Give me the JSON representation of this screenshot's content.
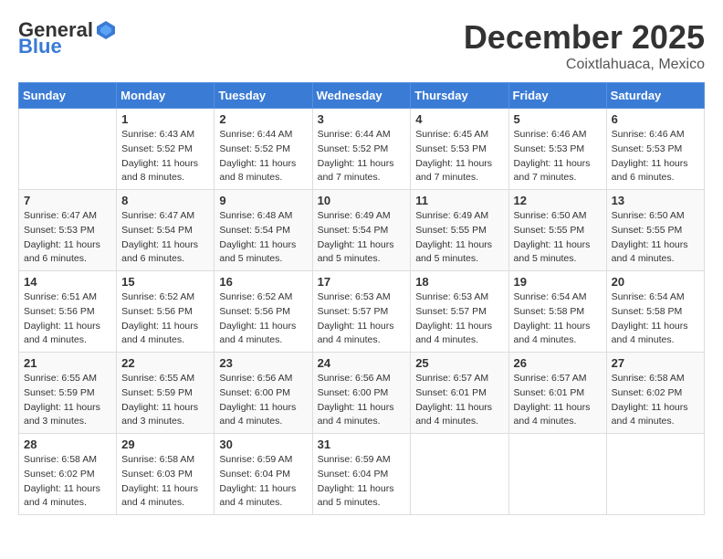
{
  "header": {
    "logo_general": "General",
    "logo_blue": "Blue",
    "month_title": "December 2025",
    "location": "Coixtlahuaca, Mexico"
  },
  "weekdays": [
    "Sunday",
    "Monday",
    "Tuesday",
    "Wednesday",
    "Thursday",
    "Friday",
    "Saturday"
  ],
  "weeks": [
    [
      {
        "day": "",
        "sunrise": "",
        "sunset": "",
        "daylight": ""
      },
      {
        "day": "1",
        "sunrise": "Sunrise: 6:43 AM",
        "sunset": "Sunset: 5:52 PM",
        "daylight": "Daylight: 11 hours and 8 minutes."
      },
      {
        "day": "2",
        "sunrise": "Sunrise: 6:44 AM",
        "sunset": "Sunset: 5:52 PM",
        "daylight": "Daylight: 11 hours and 8 minutes."
      },
      {
        "day": "3",
        "sunrise": "Sunrise: 6:44 AM",
        "sunset": "Sunset: 5:52 PM",
        "daylight": "Daylight: 11 hours and 7 minutes."
      },
      {
        "day": "4",
        "sunrise": "Sunrise: 6:45 AM",
        "sunset": "Sunset: 5:53 PM",
        "daylight": "Daylight: 11 hours and 7 minutes."
      },
      {
        "day": "5",
        "sunrise": "Sunrise: 6:46 AM",
        "sunset": "Sunset: 5:53 PM",
        "daylight": "Daylight: 11 hours and 7 minutes."
      },
      {
        "day": "6",
        "sunrise": "Sunrise: 6:46 AM",
        "sunset": "Sunset: 5:53 PM",
        "daylight": "Daylight: 11 hours and 6 minutes."
      }
    ],
    [
      {
        "day": "7",
        "sunrise": "Sunrise: 6:47 AM",
        "sunset": "Sunset: 5:53 PM",
        "daylight": "Daylight: 11 hours and 6 minutes."
      },
      {
        "day": "8",
        "sunrise": "Sunrise: 6:47 AM",
        "sunset": "Sunset: 5:54 PM",
        "daylight": "Daylight: 11 hours and 6 minutes."
      },
      {
        "day": "9",
        "sunrise": "Sunrise: 6:48 AM",
        "sunset": "Sunset: 5:54 PM",
        "daylight": "Daylight: 11 hours and 5 minutes."
      },
      {
        "day": "10",
        "sunrise": "Sunrise: 6:49 AM",
        "sunset": "Sunset: 5:54 PM",
        "daylight": "Daylight: 11 hours and 5 minutes."
      },
      {
        "day": "11",
        "sunrise": "Sunrise: 6:49 AM",
        "sunset": "Sunset: 5:55 PM",
        "daylight": "Daylight: 11 hours and 5 minutes."
      },
      {
        "day": "12",
        "sunrise": "Sunrise: 6:50 AM",
        "sunset": "Sunset: 5:55 PM",
        "daylight": "Daylight: 11 hours and 5 minutes."
      },
      {
        "day": "13",
        "sunrise": "Sunrise: 6:50 AM",
        "sunset": "Sunset: 5:55 PM",
        "daylight": "Daylight: 11 hours and 4 minutes."
      }
    ],
    [
      {
        "day": "14",
        "sunrise": "Sunrise: 6:51 AM",
        "sunset": "Sunset: 5:56 PM",
        "daylight": "Daylight: 11 hours and 4 minutes."
      },
      {
        "day": "15",
        "sunrise": "Sunrise: 6:52 AM",
        "sunset": "Sunset: 5:56 PM",
        "daylight": "Daylight: 11 hours and 4 minutes."
      },
      {
        "day": "16",
        "sunrise": "Sunrise: 6:52 AM",
        "sunset": "Sunset: 5:56 PM",
        "daylight": "Daylight: 11 hours and 4 minutes."
      },
      {
        "day": "17",
        "sunrise": "Sunrise: 6:53 AM",
        "sunset": "Sunset: 5:57 PM",
        "daylight": "Daylight: 11 hours and 4 minutes."
      },
      {
        "day": "18",
        "sunrise": "Sunrise: 6:53 AM",
        "sunset": "Sunset: 5:57 PM",
        "daylight": "Daylight: 11 hours and 4 minutes."
      },
      {
        "day": "19",
        "sunrise": "Sunrise: 6:54 AM",
        "sunset": "Sunset: 5:58 PM",
        "daylight": "Daylight: 11 hours and 4 minutes."
      },
      {
        "day": "20",
        "sunrise": "Sunrise: 6:54 AM",
        "sunset": "Sunset: 5:58 PM",
        "daylight": "Daylight: 11 hours and 4 minutes."
      }
    ],
    [
      {
        "day": "21",
        "sunrise": "Sunrise: 6:55 AM",
        "sunset": "Sunset: 5:59 PM",
        "daylight": "Daylight: 11 hours and 3 minutes."
      },
      {
        "day": "22",
        "sunrise": "Sunrise: 6:55 AM",
        "sunset": "Sunset: 5:59 PM",
        "daylight": "Daylight: 11 hours and 3 minutes."
      },
      {
        "day": "23",
        "sunrise": "Sunrise: 6:56 AM",
        "sunset": "Sunset: 6:00 PM",
        "daylight": "Daylight: 11 hours and 4 minutes."
      },
      {
        "day": "24",
        "sunrise": "Sunrise: 6:56 AM",
        "sunset": "Sunset: 6:00 PM",
        "daylight": "Daylight: 11 hours and 4 minutes."
      },
      {
        "day": "25",
        "sunrise": "Sunrise: 6:57 AM",
        "sunset": "Sunset: 6:01 PM",
        "daylight": "Daylight: 11 hours and 4 minutes."
      },
      {
        "day": "26",
        "sunrise": "Sunrise: 6:57 AM",
        "sunset": "Sunset: 6:01 PM",
        "daylight": "Daylight: 11 hours and 4 minutes."
      },
      {
        "day": "27",
        "sunrise": "Sunrise: 6:58 AM",
        "sunset": "Sunset: 6:02 PM",
        "daylight": "Daylight: 11 hours and 4 minutes."
      }
    ],
    [
      {
        "day": "28",
        "sunrise": "Sunrise: 6:58 AM",
        "sunset": "Sunset: 6:02 PM",
        "daylight": "Daylight: 11 hours and 4 minutes."
      },
      {
        "day": "29",
        "sunrise": "Sunrise: 6:58 AM",
        "sunset": "Sunset: 6:03 PM",
        "daylight": "Daylight: 11 hours and 4 minutes."
      },
      {
        "day": "30",
        "sunrise": "Sunrise: 6:59 AM",
        "sunset": "Sunset: 6:04 PM",
        "daylight": "Daylight: 11 hours and 4 minutes."
      },
      {
        "day": "31",
        "sunrise": "Sunrise: 6:59 AM",
        "sunset": "Sunset: 6:04 PM",
        "daylight": "Daylight: 11 hours and 5 minutes."
      },
      {
        "day": "",
        "sunrise": "",
        "sunset": "",
        "daylight": ""
      },
      {
        "day": "",
        "sunrise": "",
        "sunset": "",
        "daylight": ""
      },
      {
        "day": "",
        "sunrise": "",
        "sunset": "",
        "daylight": ""
      }
    ]
  ]
}
